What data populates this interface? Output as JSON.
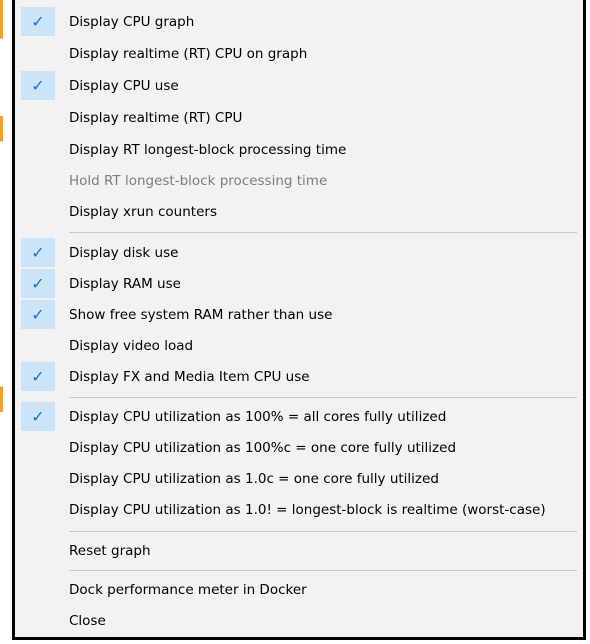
{
  "menu": {
    "items": [
      {
        "label": "Display CPU graph",
        "checked": true,
        "enabled": true
      },
      {
        "label": "Display realtime (RT) CPU on graph",
        "checked": false,
        "enabled": true
      },
      {
        "label": "Display CPU use",
        "checked": true,
        "enabled": true
      },
      {
        "label": "Display realtime (RT) CPU",
        "checked": false,
        "enabled": true
      },
      {
        "label": "Display RT longest-block processing time",
        "checked": false,
        "enabled": true
      },
      {
        "label": "Hold RT longest-block processing time",
        "checked": false,
        "enabled": false
      },
      {
        "label": "Display xrun counters",
        "checked": false,
        "enabled": true
      },
      {
        "label": "Display disk use",
        "checked": true,
        "enabled": true
      },
      {
        "label": "Display RAM use",
        "checked": true,
        "enabled": true
      },
      {
        "label": "Show free system RAM rather than use",
        "checked": true,
        "enabled": true
      },
      {
        "label": "Display video load",
        "checked": false,
        "enabled": true
      },
      {
        "label": "Display FX and Media Item CPU use",
        "checked": true,
        "enabled": true
      },
      {
        "label": "Display CPU utilization as 100% = all cores fully utilized",
        "checked": true,
        "enabled": true
      },
      {
        "label": "Display CPU utilization as 100%c = one core fully utilized",
        "checked": false,
        "enabled": true
      },
      {
        "label": "Display CPU utilization as 1.0c = one core fully utilized",
        "checked": false,
        "enabled": true
      },
      {
        "label": "Display CPU utilization as 1.0! = longest-block is realtime (worst-case)",
        "checked": false,
        "enabled": true
      },
      {
        "label": "Reset graph",
        "checked": false,
        "enabled": true
      },
      {
        "label": "Dock performance meter in Docker",
        "checked": false,
        "enabled": true
      },
      {
        "label": "Close",
        "checked": false,
        "enabled": true
      }
    ],
    "check_glyph": "✓",
    "colors": {
      "menu_bg": "#f2f2f2",
      "check_bg": "#cce4f7",
      "check_fg": "#1a73c8",
      "disabled_text": "#7d7d7d",
      "separator": "#c8c8c8"
    }
  }
}
